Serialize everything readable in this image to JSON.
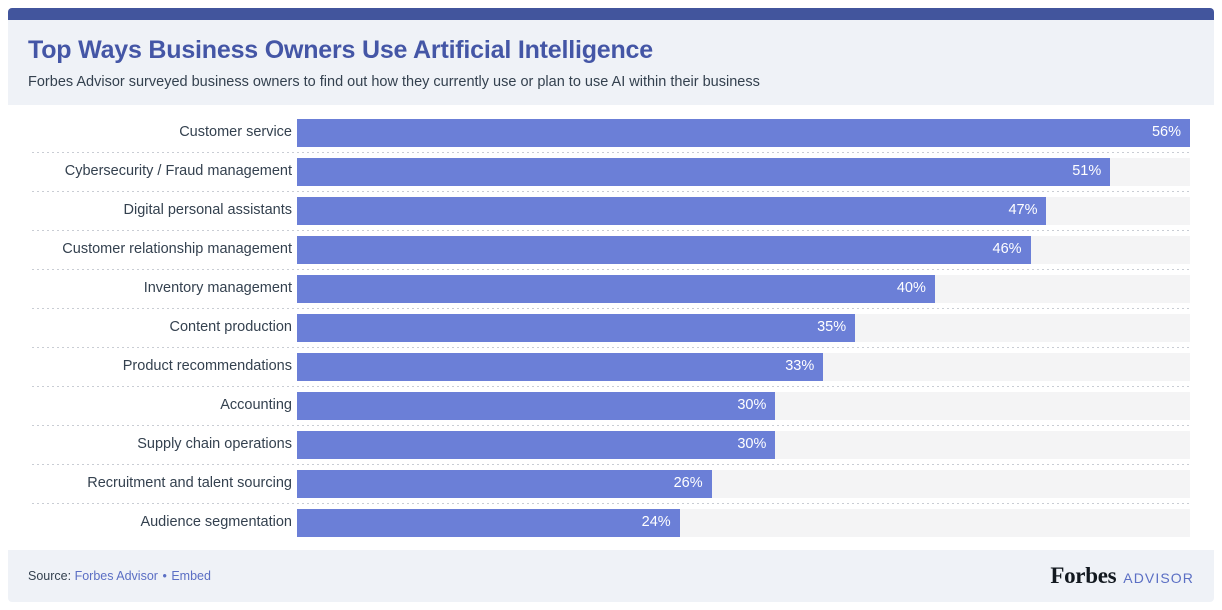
{
  "header": {
    "title": "Top Ways Business Owners Use Artificial Intelligence",
    "subtitle": "Forbes Advisor surveyed business owners to find out how they currently use or plan to use AI within their business"
  },
  "footer": {
    "source_prefix": "Source:",
    "source_link": "Forbes Advisor",
    "separator": "•",
    "embed_link": "Embed",
    "brand_primary": "Forbes",
    "brand_secondary": "ADVISOR"
  },
  "colors": {
    "top_rule": "#42559d",
    "title": "#4456a6",
    "bar_fill": "#6b7fd7",
    "bar_track": "#f4f4f5",
    "band_background": "#eff2f7",
    "text": "#34414f",
    "link": "#5b6fc4"
  },
  "chart_data": {
    "type": "bar",
    "orientation": "horizontal",
    "title": "Top Ways Business Owners Use Artificial Intelligence",
    "subtitle": "Forbes Advisor surveyed business owners to find out how they currently use or plan to use AI within their business",
    "xlabel": "",
    "ylabel": "",
    "xlim": [
      0,
      56
    ],
    "grid": false,
    "legend": false,
    "value_suffix": "%",
    "categories": [
      "Customer service",
      "Cybersecurity / Fraud management",
      "Digital personal assistants",
      "Customer relationship management",
      "Inventory management",
      "Content production",
      "Product recommendations",
      "Accounting",
      "Supply chain operations",
      "Recruitment and talent sourcing",
      "Audience segmentation"
    ],
    "values": [
      56,
      51,
      47,
      46,
      40,
      35,
      33,
      30,
      30,
      26,
      24
    ],
    "value_labels": [
      "56%",
      "51%",
      "47%",
      "46%",
      "40%",
      "35%",
      "33%",
      "30%",
      "30%",
      "26%",
      "24%"
    ]
  }
}
